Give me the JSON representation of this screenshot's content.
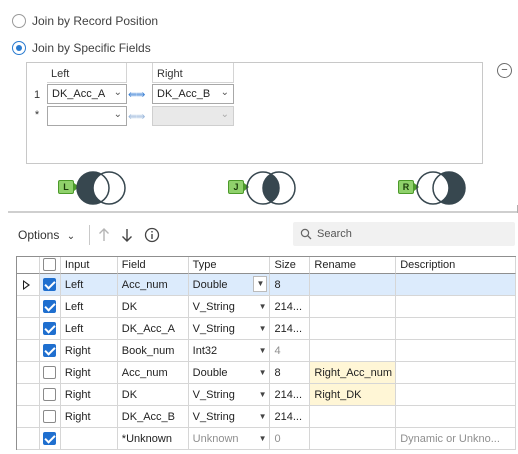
{
  "join_options": {
    "by_position_label": "Join by Record Position",
    "by_fields_label": "Join by Specific Fields"
  },
  "join_fields": {
    "left_header": "Left",
    "right_header": "Right",
    "rows": [
      {
        "num": "1",
        "left": "DK_Acc_A",
        "right": "DK_Acc_B"
      },
      {
        "num": "*",
        "left": "",
        "right": ""
      }
    ]
  },
  "outputs": {
    "left_tag": "L",
    "join_tag": "J",
    "right_tag": "R",
    "venn_fill": "#37474f",
    "tag_color": "#8fd16b"
  },
  "toolbar": {
    "options_label": "Options",
    "search_placeholder": "Search"
  },
  "grid": {
    "columns": [
      "Input",
      "Field",
      "Type",
      "Size",
      "Rename",
      "Description"
    ],
    "rows": [
      {
        "checked": true,
        "input": "Left",
        "field": "Acc_num",
        "type": "Double",
        "size": "8",
        "rename": "",
        "description": "",
        "selected": true,
        "dim": false
      },
      {
        "checked": true,
        "input": "Left",
        "field": "DK",
        "type": "V_String",
        "size": "214...",
        "rename": "",
        "description": "",
        "selected": false,
        "dim": false
      },
      {
        "checked": true,
        "input": "Left",
        "field": "DK_Acc_A",
        "type": "V_String",
        "size": "214...",
        "rename": "",
        "description": "",
        "selected": false,
        "dim": false
      },
      {
        "checked": true,
        "input": "Right",
        "field": "Book_num",
        "type": "Int32",
        "size": "4",
        "rename": "",
        "description": "",
        "selected": false,
        "dim": false
      },
      {
        "checked": false,
        "input": "Right",
        "field": "Acc_num",
        "type": "Double",
        "size": "8",
        "rename": "Right_Acc_num",
        "description": "",
        "selected": false,
        "dim": false
      },
      {
        "checked": false,
        "input": "Right",
        "field": "DK",
        "type": "V_String",
        "size": "214...",
        "rename": "Right_DK",
        "description": "",
        "selected": false,
        "dim": false
      },
      {
        "checked": false,
        "input": "Right",
        "field": "DK_Acc_B",
        "type": "V_String",
        "size": "214...",
        "rename": "",
        "description": "",
        "selected": false,
        "dim": false
      },
      {
        "checked": true,
        "input": "",
        "field": "*Unknown",
        "type": "Unknown",
        "size": "0",
        "rename": "",
        "description": "Dynamic or Unkno...",
        "selected": false,
        "dim": true
      }
    ]
  }
}
